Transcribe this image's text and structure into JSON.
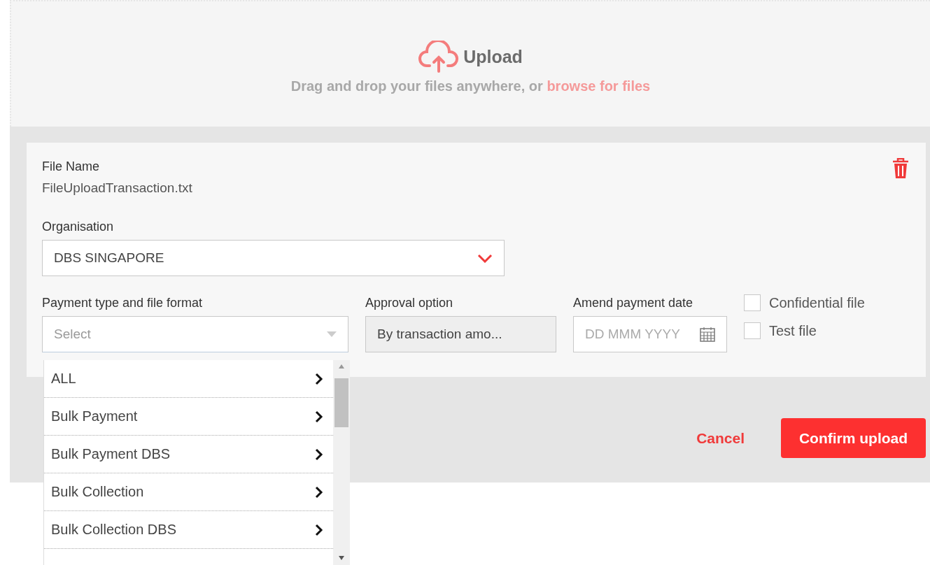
{
  "upload": {
    "title": "Upload",
    "hint_prefix": "Drag and drop your files anywhere, or",
    "link": "browse for files"
  },
  "file": {
    "name_label": "File Name",
    "name": "FileUploadTransaction.txt"
  },
  "organisation": {
    "label": "Organisation",
    "value": "DBS SINGAPORE"
  },
  "payment_type": {
    "label": "Payment type and file format",
    "placeholder": "Select",
    "expanded": true
  },
  "approval": {
    "label": "Approval option",
    "value": "By transaction amo...",
    "disabled": true
  },
  "date": {
    "label": "Amend payment date",
    "placeholder": "DD MMM YYYY"
  },
  "checkboxes": [
    {
      "label": "Confidential file",
      "checked": false
    },
    {
      "label": "Test file",
      "checked": false
    }
  ],
  "dropdown_items": [
    {
      "label": "ALL"
    },
    {
      "label": "Bulk Payment"
    },
    {
      "label": "Bulk Payment DBS"
    },
    {
      "label": "Bulk Collection"
    },
    {
      "label": "Bulk Collection DBS"
    }
  ],
  "buttons": {
    "cancel": "Cancel",
    "confirm": "Confirm upload"
  }
}
